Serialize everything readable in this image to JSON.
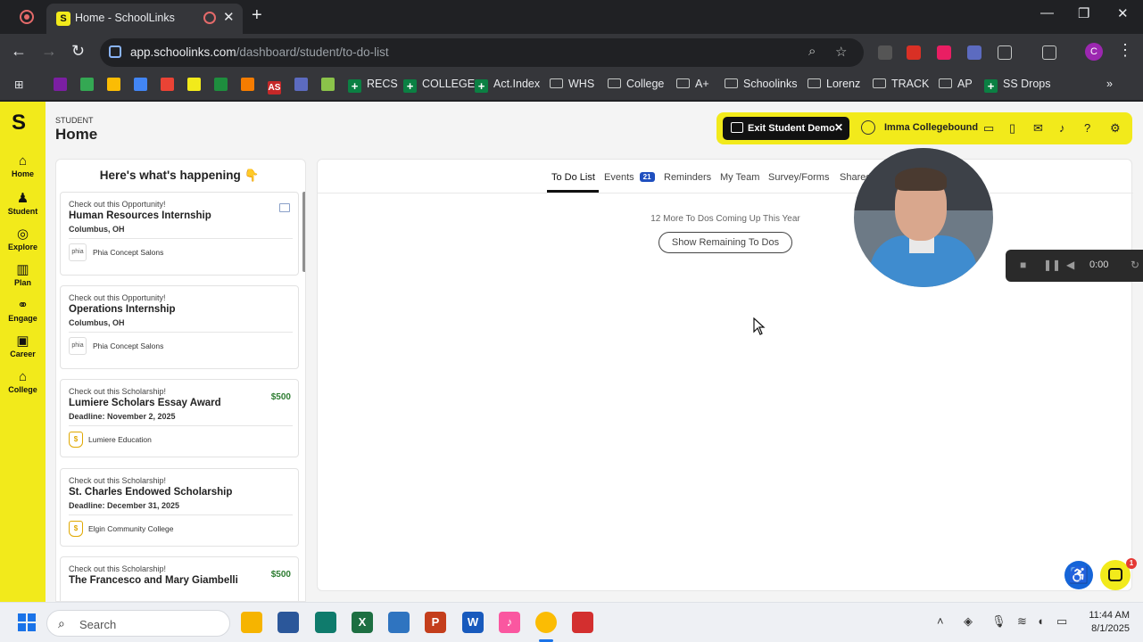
{
  "browser": {
    "tab_title": "Home - SchoolLinks",
    "tab_favicon": "S",
    "new_tab_label": "+",
    "url_host": "app.schoolinks.com",
    "url_path": "/dashboard/student/to-do-list",
    "profile_initial": "C",
    "bookmarks": [
      {
        "label": "RECS",
        "kind": "plus"
      },
      {
        "label": "COLLEGE",
        "kind": "plus"
      },
      {
        "label": "Act.Index",
        "kind": "plus"
      },
      {
        "label": "WHS",
        "kind": "folder"
      },
      {
        "label": "College",
        "kind": "folder"
      },
      {
        "label": "A+",
        "kind": "folder"
      },
      {
        "label": "Schoolinks",
        "kind": "folder"
      },
      {
        "label": "Lorenz",
        "kind": "folder"
      },
      {
        "label": "TRACK",
        "kind": "folder"
      },
      {
        "label": "AP",
        "kind": "folder"
      },
      {
        "label": "SS Drops",
        "kind": "plus"
      }
    ],
    "bookmark_as_label": "AS"
  },
  "sidebar": {
    "logo": "S",
    "items": [
      {
        "label": "Home",
        "icon": "home-icon",
        "glyph": "⌂"
      },
      {
        "label": "Student",
        "icon": "person-icon",
        "glyph": "♟"
      },
      {
        "label": "Explore",
        "icon": "compass-icon",
        "glyph": "◎"
      },
      {
        "label": "Plan",
        "icon": "book-icon",
        "glyph": "▥"
      },
      {
        "label": "Engage",
        "icon": "handshake-icon",
        "glyph": "⚭"
      },
      {
        "label": "Career",
        "icon": "briefcase-icon",
        "glyph": "▣"
      },
      {
        "label": "College",
        "icon": "institution-icon",
        "glyph": "⌂"
      }
    ]
  },
  "header": {
    "breadcrumb": "STUDENT",
    "title": "Home",
    "exit_demo_label": "Exit Student Demo",
    "exit_x": "✕",
    "user_name": "Imma Collegebound"
  },
  "feed": {
    "title": "Here's what's happening 👇",
    "cards": [
      {
        "kicker": "Check out this Opportunity!",
        "title": "Human Resources Internship",
        "sub": "Columbus, OH",
        "org": "Phia Concept Salons",
        "logo_text": "phia",
        "amount": ""
      },
      {
        "kicker": "Check out this Opportunity!",
        "title": "Operations Internship",
        "sub": "Columbus, OH",
        "org": "Phia Concept Salons",
        "logo_text": "phia",
        "amount": ""
      },
      {
        "kicker": "Check out this Scholarship!",
        "title": "Lumiere Scholars Essay Award",
        "sub": "Deadline: November 2, 2025",
        "org": "Lumiere Education",
        "logo_text": "$",
        "amount": "$500"
      },
      {
        "kicker": "Check out this Scholarship!",
        "title": "St. Charles Endowed Scholarship",
        "sub": "Deadline: December 31, 2025",
        "org": "Elgin Community College",
        "logo_text": "$",
        "amount": ""
      },
      {
        "kicker": "Check out this Scholarship!",
        "title": "The Francesco and Mary Giambelli",
        "sub": "",
        "org": "",
        "logo_text": "",
        "amount": "$500"
      }
    ]
  },
  "main": {
    "tabs": [
      {
        "label": "To Do List",
        "active": true
      },
      {
        "label": "Events",
        "badge": "21"
      },
      {
        "label": "Reminders"
      },
      {
        "label": "My Team"
      },
      {
        "label": "Survey/Forms"
      },
      {
        "label": "Shared"
      }
    ],
    "coming_text": "12 More To Dos Coming Up This Year",
    "show_button": "Show Remaining To Dos"
  },
  "recorder": {
    "time": "0:00"
  },
  "chat": {
    "badge": "1"
  },
  "taskbar": {
    "search_label": "Search",
    "time": "11:44 AM",
    "date": "8/1/2025"
  },
  "colors": {
    "brand_yellow": "#f2ea1b",
    "badge_blue": "#1f4fbf",
    "amount_green": "#2e7d32"
  }
}
